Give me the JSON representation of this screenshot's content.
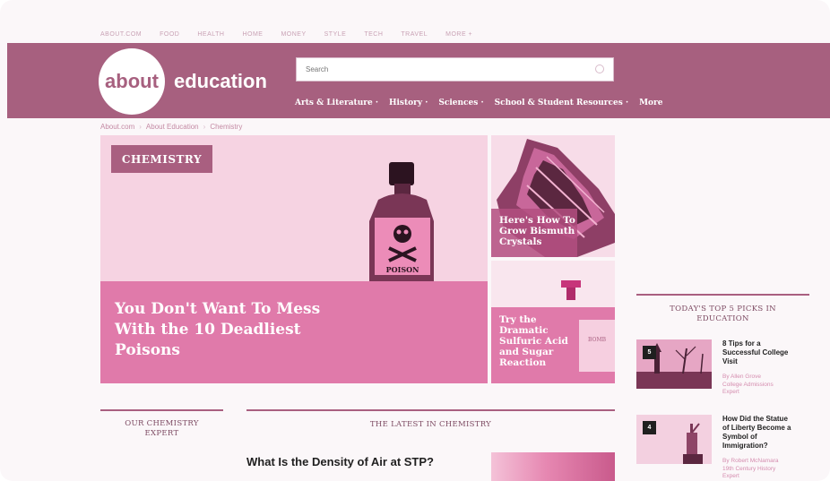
{
  "global_nav": [
    "ABOUT.COM",
    "FOOD",
    "HEALTH",
    "HOME",
    "MONEY",
    "STYLE",
    "TECH",
    "TRAVEL",
    "MORE +"
  ],
  "logo": {
    "word1": "about",
    "word2": "education"
  },
  "search": {
    "placeholder": "Search"
  },
  "category_nav": [
    "Arts & Literature ·",
    "History ·",
    "Sciences ·",
    "School & Student Resources ·",
    "More"
  ],
  "breadcrumb": [
    "About.com",
    "About Education",
    "Chemistry"
  ],
  "hero": {
    "tag": "CHEMISTRY",
    "bottle_label": "POISON",
    "title_lines": [
      "You Don't Want To Mess",
      "With the 10 Deadliest",
      "Poisons"
    ]
  },
  "tiles": [
    {
      "title_lines": [
        "Here's How To",
        "Grow Bismuth",
        "Crystals"
      ]
    },
    {
      "title_lines": [
        "Try the",
        "Dramatic",
        "Sulfuric Acid",
        "and Sugar",
        "Reaction"
      ],
      "beaker_label": "BOMB"
    }
  ],
  "picks": {
    "heading_lines": [
      "TODAY'S TOP 5 PICKS IN",
      "EDUCATION"
    ],
    "items": [
      {
        "number": "5",
        "title_lines": [
          "8 Tips for a",
          "Successful College",
          "Visit"
        ],
        "byline_lines": [
          "By Allen Grove",
          "College Admissions",
          "Expert"
        ]
      },
      {
        "number": "4",
        "title_lines": [
          "How Did the Statue",
          "of Liberty Become a",
          "Symbol of",
          "Immigration?"
        ],
        "byline_lines": [
          "By Robert McNamara",
          "19th Century History",
          "Expert"
        ]
      }
    ]
  },
  "expert": {
    "heading_lines": [
      "OUR CHEMISTRY",
      "EXPERT"
    ]
  },
  "latest": {
    "heading": "THE LATEST IN CHEMISTRY",
    "article_title": "What Is the Density of Air at STP?"
  },
  "colors": {
    "brand": "#a7607f",
    "accent_pink": "#e07aaa",
    "pale_pink": "#f6d3e2"
  },
  "icons": [
    "search-icon",
    "skull-crossbones-icon"
  ]
}
